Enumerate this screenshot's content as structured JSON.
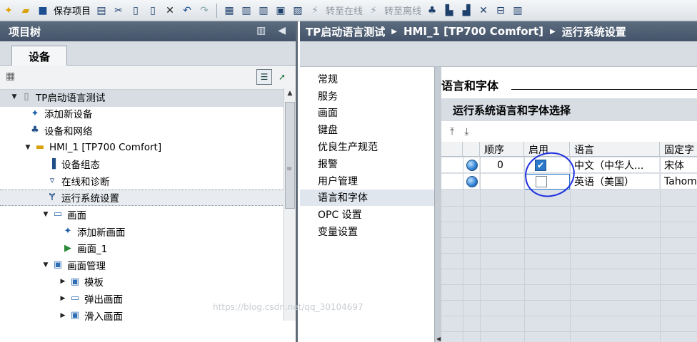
{
  "toolbar": {
    "save_label": "保存项目",
    "go_online": "转至在线",
    "go_offline": "转至离线"
  },
  "left_panel": {
    "title": "项目树",
    "tab": "设备",
    "tree": [
      {
        "label": "TP启动语言测试",
        "icon": "project-icon",
        "expand": "▼"
      },
      {
        "label": "添加新设备",
        "icon": "add-device-icon",
        "expand": ""
      },
      {
        "label": "设备和网络",
        "icon": "network-icon",
        "expand": ""
      },
      {
        "label": "HMI_1 [TP700 Comfort]",
        "icon": "hmi-icon",
        "expand": "▼"
      },
      {
        "label": "设备组态",
        "icon": "device-config-icon",
        "expand": ""
      },
      {
        "label": "在线和诊断",
        "icon": "diagnostics-icon",
        "expand": ""
      },
      {
        "label": "运行系统设置",
        "icon": "runtime-settings-icon",
        "expand": ""
      },
      {
        "label": "画面",
        "icon": "folder-icon",
        "expand": "▼"
      },
      {
        "label": "添加新画面",
        "icon": "add-screen-icon",
        "expand": ""
      },
      {
        "label": "画面_1",
        "icon": "screen-icon",
        "expand": ""
      },
      {
        "label": "画面管理",
        "icon": "folder-icon",
        "expand": "▼"
      },
      {
        "label": "模板",
        "icon": "folder-icon",
        "expand": "▶"
      },
      {
        "label": "弹出画面",
        "icon": "folder-icon",
        "expand": "▶"
      },
      {
        "label": "滑入画面",
        "icon": "folder-icon",
        "expand": "▶"
      }
    ]
  },
  "breadcrumb": {
    "project": "TP启动语言测试",
    "device": "HMI_1 [TP700 Comfort]",
    "page": "运行系统设置"
  },
  "nav": {
    "items": [
      "常规",
      "服务",
      "画面",
      "键盘",
      "优良生产规范",
      "报警",
      "用户管理",
      "语言和字体",
      "OPC 设置",
      "变量设置"
    ],
    "active": "语言和字体"
  },
  "content": {
    "section_title": "语言和字体",
    "sub_title": "运行系统语言和字体选择",
    "columns": [
      "",
      "顺序",
      "启用",
      "语言",
      "固定字"
    ],
    "rows": [
      {
        "order": "0",
        "enabled": true,
        "language": "中文（中华人...",
        "font": "宋体"
      },
      {
        "order": "",
        "enabled": false,
        "language": "英语（美国）",
        "font": "Tahom"
      }
    ]
  },
  "watermark": "https://blog.csdn.net/qq_30104697"
}
